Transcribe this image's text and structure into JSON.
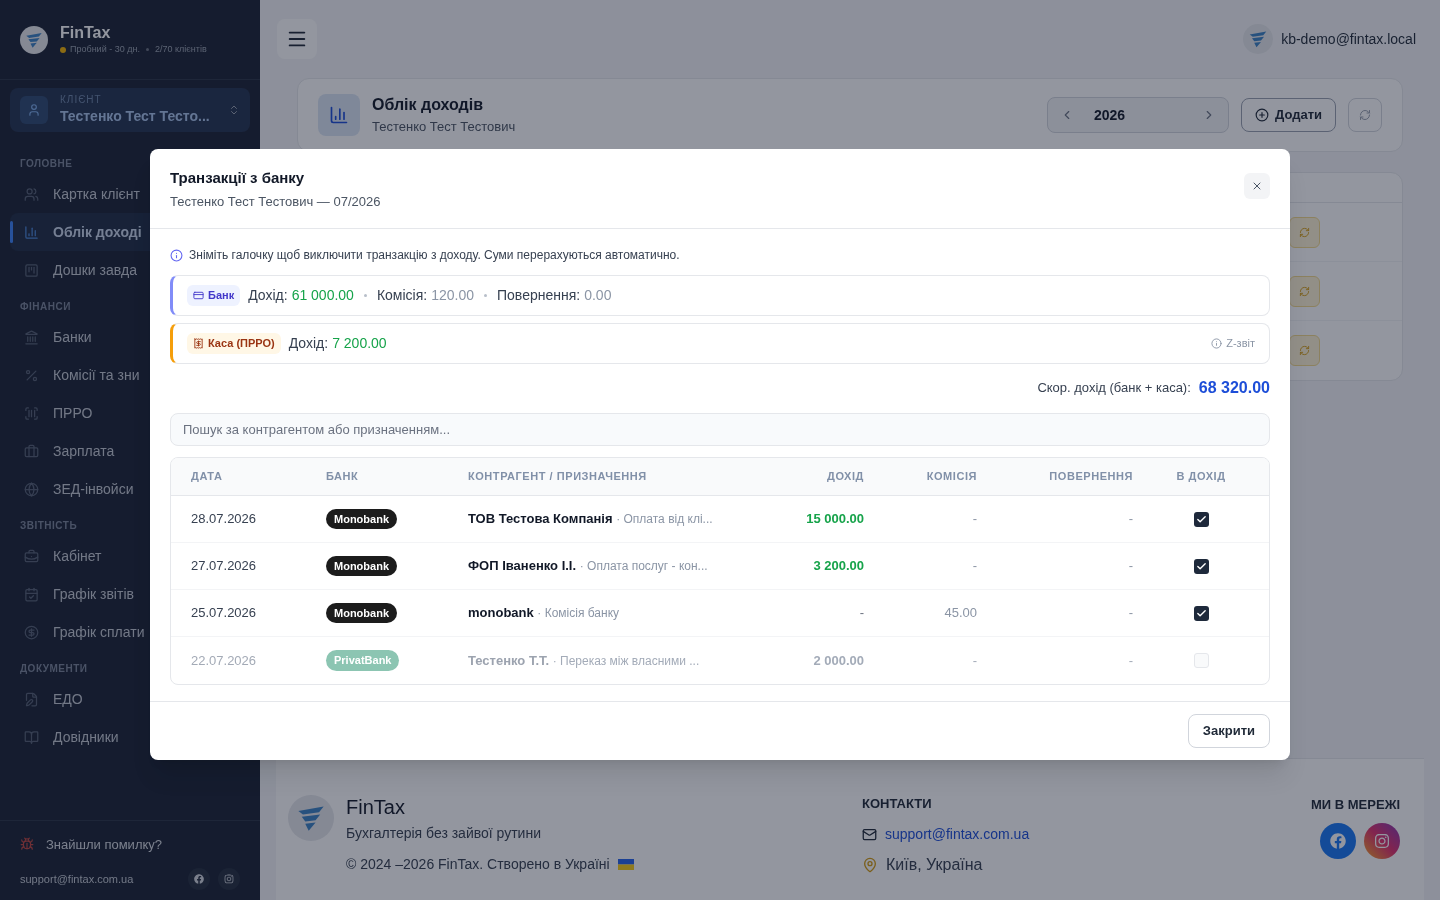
{
  "sidebar": {
    "brand": "FinTax",
    "plan": "Пробний - 30 дн.",
    "clients": "2/70 клієнтів",
    "client_selector": {
      "label": "КЛІЄНТ",
      "value": "Тестенко Тест Тесто..."
    },
    "sections": [
      {
        "title": "ГОЛОВНЕ",
        "items": [
          {
            "label": "Картка клієнт",
            "selected": false
          },
          {
            "label": "Облік доході",
            "selected": true
          },
          {
            "label": "Дошки завда",
            "selected": false
          }
        ]
      },
      {
        "title": "ФІНАНСИ",
        "items": [
          {
            "label": "Банки",
            "selected": false
          },
          {
            "label": "Комісії та зни",
            "selected": false
          },
          {
            "label": "ПРРО",
            "selected": false
          },
          {
            "label": "Зарплата",
            "selected": false
          },
          {
            "label": "ЗЕД-інвойси",
            "selected": false
          }
        ]
      },
      {
        "title": "ЗВІТНІСТЬ",
        "items": [
          {
            "label": "Кабінет",
            "selected": false
          },
          {
            "label": "Графік звітів",
            "selected": false
          },
          {
            "label": "Графік сплати",
            "selected": false
          }
        ]
      },
      {
        "title": "ДОКУМЕНТИ",
        "items": [
          {
            "label": "ЕДО",
            "selected": false
          },
          {
            "label": "Довідники",
            "selected": false
          }
        ]
      }
    ],
    "bug_report": "Знайшли помилку?",
    "support_email": "support@fintax.com.ua"
  },
  "topbar": {
    "user_email": "kb-demo@fintax.local"
  },
  "page_header": {
    "title": "Облік доходів",
    "subtitle": "Тестенко Тест Тестович",
    "year": "2026",
    "add_button": "Додати"
  },
  "modal": {
    "title": "Транзакції з банку",
    "subtitle": "Тестенко Тест Тестович — 07/2026",
    "info": "Зніміть галочку щоб виключити транзакцію з доходу. Суми перерахуються автоматично.",
    "bank_summary": {
      "badge": "Банк",
      "income_label": "Дохід:",
      "income": "61 000.00",
      "commission_label": "Комісія:",
      "commission": "120.00",
      "refunds_label": "Повернення:",
      "refunds": "0.00"
    },
    "cash_summary": {
      "badge": "Каса (ПРРО)",
      "income_label": "Дохід:",
      "income": "7 200.00",
      "z_report": "Z-звіт"
    },
    "total_label": "Скор. дохід (банк + каса):",
    "total": "68 320.00",
    "search": {
      "placeholder": "Пошук за контрагентом або призначенням..."
    },
    "columns": [
      "ДАТА",
      "БАНК",
      "КОНТРАГЕНТ / ПРИЗНАЧЕННЯ",
      "ДОХІД",
      "КОМІСІЯ",
      "ПОВЕРНЕННЯ",
      "В ДОХІД"
    ],
    "rows": [
      {
        "date": "28.07.2026",
        "bank": "Monobank",
        "color": "#1c1c1c",
        "counterparty": "ТОВ Тестова Компанія",
        "purpose": "· Оплата від клі...",
        "income": "15 000.00",
        "commission": "-",
        "refund": "-",
        "kind": "income",
        "included": true
      },
      {
        "date": "27.07.2026",
        "bank": "Monobank",
        "color": "#1c1c1c",
        "counterparty": "ФОП Іваненко І.І.",
        "purpose": "· Оплата послуг - кон...",
        "income": "3 200.00",
        "commission": "-",
        "refund": "-",
        "kind": "income",
        "included": true
      },
      {
        "date": "25.07.2026",
        "bank": "Monobank",
        "color": "#1c1c1c",
        "counterparty": "monobank",
        "purpose": "· Комісія банку",
        "income": "-",
        "commission": "45.00",
        "refund": "-",
        "kind": "fee",
        "included": true
      },
      {
        "date": "22.07.2026",
        "bank": "PrivatBank",
        "color": "#8cc5b2",
        "counterparty": "Тестенко Т.Т.",
        "purpose": "· Переказ між власними ...",
        "income": "2 000.00",
        "commission": "-",
        "refund": "-",
        "kind": "income",
        "included": false
      }
    ],
    "close_button": "Закрити"
  },
  "footer": {
    "brand": "FinTax",
    "tagline": "Бухгалтерія без зайвої рутини",
    "copyright": "© 2024 –2026 FinTax. Створено в Україні",
    "contacts_title": "КОНТАКТИ",
    "email": "support@fintax.com.ua",
    "location": "Київ, Україна",
    "social_title": "МИ В МЕРЕЖІ"
  }
}
